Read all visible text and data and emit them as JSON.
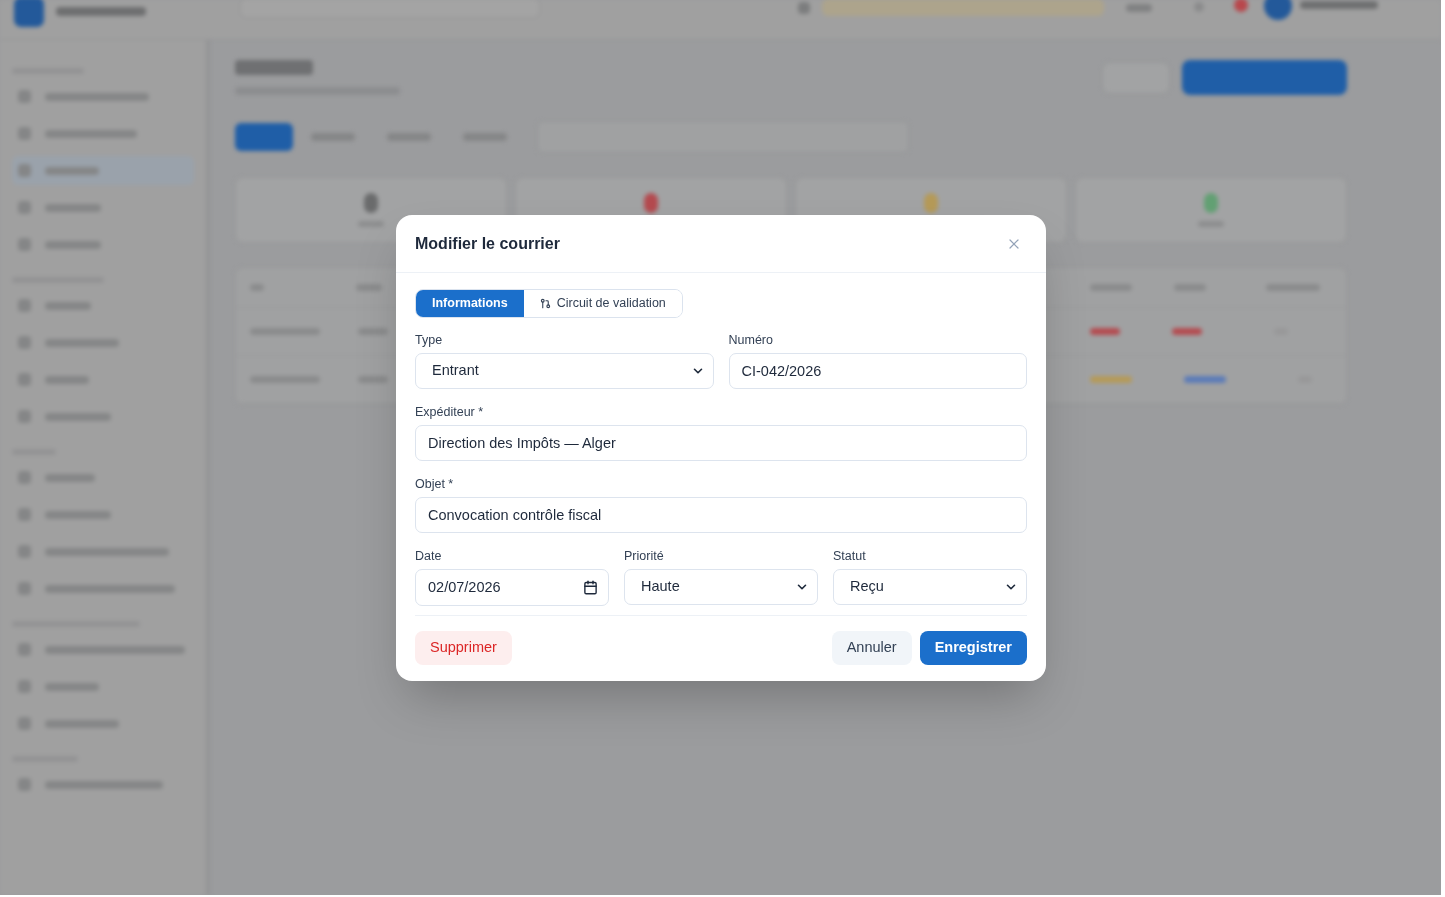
{
  "dialog": {
    "title": "Modifier le courrier",
    "tabs": [
      {
        "label": "Informations",
        "kind": "text",
        "selected": true
      },
      {
        "label": "Circuit de validation",
        "kind": "with_icon",
        "selected": false
      }
    ],
    "form_rows": [
      [
        {
          "label": "Type",
          "kind": "select",
          "value": "Entrant"
        },
        {
          "label": "Numéro",
          "kind": "text",
          "value": "CI-042/2026"
        }
      ],
      [
        {
          "label": "Expéditeur *",
          "kind": "text",
          "value": "Direction des Impôts — Alger"
        }
      ],
      [
        {
          "label": "Objet *",
          "kind": "text",
          "value": "Convocation contrôle fiscal"
        }
      ],
      [
        {
          "label": "Date",
          "kind": "date",
          "value": "02/07/2026"
        },
        {
          "label": "Priorité",
          "kind": "select",
          "value": "Haute"
        },
        {
          "label": "Statut",
          "kind": "select",
          "value": "Reçu"
        }
      ]
    ],
    "actions": [
      {
        "label": "Supprimer",
        "kind": "danger"
      },
      {
        "label": "Annuler",
        "kind": "secondary"
      },
      {
        "label": "Enregistrer",
        "kind": "primary"
      }
    ]
  }
}
